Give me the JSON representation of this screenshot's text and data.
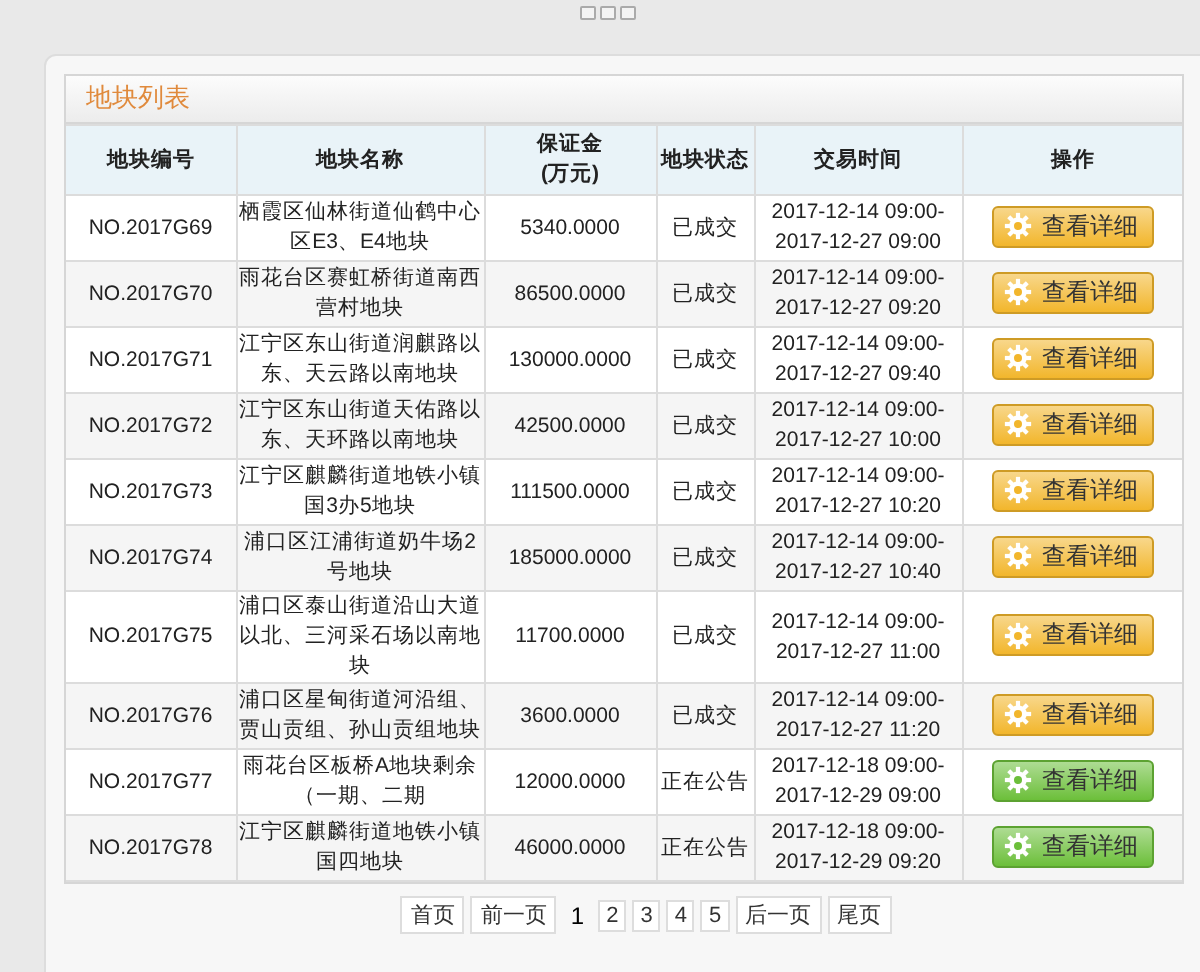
{
  "panel": {
    "title": "地块列表"
  },
  "table": {
    "columns": [
      "地块编号",
      "地块名称",
      "保证金\n(万元)",
      "地块状态",
      "交易时间",
      "操作"
    ],
    "rows": [
      {
        "code": "NO.2017G69",
        "name": "栖霞区仙林街道仙鹤中心区E3、E4地块",
        "deposit": "5340.0000",
        "status": "已成交",
        "time_start": "2017-12-14 09:00-",
        "time_end": "2017-12-27 09:00",
        "button": {
          "label": "查看详细",
          "color": "#f2b62c"
        }
      },
      {
        "code": "NO.2017G70",
        "name": "雨花台区赛虹桥街道南西营村地块",
        "deposit": "86500.0000",
        "status": "已成交",
        "time_start": "2017-12-14 09:00-",
        "time_end": "2017-12-27 09:20",
        "button": {
          "label": "查看详细",
          "color": "#f2b62c"
        }
      },
      {
        "code": "NO.2017G71",
        "name": "江宁区东山街道润麒路以东、天云路以南地块",
        "deposit": "130000.0000",
        "status": "已成交",
        "time_start": "2017-12-14 09:00-",
        "time_end": "2017-12-27 09:40",
        "button": {
          "label": "查看详细",
          "color": "#f2b62c"
        }
      },
      {
        "code": "NO.2017G72",
        "name": "江宁区东山街道天佑路以东、天环路以南地块",
        "deposit": "42500.0000",
        "status": "已成交",
        "time_start": "2017-12-14 09:00-",
        "time_end": "2017-12-27 10:00",
        "button": {
          "label": "查看详细",
          "color": "#f2b62c"
        }
      },
      {
        "code": "NO.2017G73",
        "name": "江宁区麒麟街道地铁小镇国3办5地块",
        "deposit": "111500.0000",
        "status": "已成交",
        "time_start": "2017-12-14 09:00-",
        "time_end": "2017-12-27 10:20",
        "button": {
          "label": "查看详细",
          "color": "#f2b62c"
        }
      },
      {
        "code": "NO.2017G74",
        "name": "浦口区江浦街道奶牛场2号地块",
        "deposit": "185000.0000",
        "status": "已成交",
        "time_start": "2017-12-14 09:00-",
        "time_end": "2017-12-27 10:40",
        "button": {
          "label": "查看详细",
          "color": "#f2b62c"
        }
      },
      {
        "code": "NO.2017G75",
        "name": "浦口区泰山街道沿山大道以北、三河采石场以南地块",
        "deposit": "11700.0000",
        "status": "已成交",
        "time_start": "2017-12-14 09:00-",
        "time_end": "2017-12-27 11:00",
        "button": {
          "label": "查看详细",
          "color": "#f2b62c"
        }
      },
      {
        "code": "NO.2017G76",
        "name": "浦口区星甸街道河沿组、贾山贡组、孙山贡组地块",
        "deposit": "3600.0000",
        "status": "已成交",
        "time_start": "2017-12-14 09:00-",
        "time_end": "2017-12-27 11:20",
        "button": {
          "label": "查看详细",
          "color": "#f2b62c"
        }
      },
      {
        "code": "NO.2017G77",
        "name": "雨花台区板桥A地块剩余（一期、二期",
        "deposit": "12000.0000",
        "status": "正在公告",
        "time_start": "2017-12-18 09:00-",
        "time_end": "2017-12-29 09:00",
        "button": {
          "label": "查看详细",
          "color": "#6cbf3a"
        }
      },
      {
        "code": "NO.2017G78",
        "name": "江宁区麒麟街道地铁小镇国四地块",
        "deposit": "46000.0000",
        "status": "正在公告",
        "time_start": "2017-12-18 09:00-",
        "time_end": "2017-12-29 09:20",
        "button": {
          "label": "查看详细",
          "color": "#6cbf3a"
        }
      }
    ]
  },
  "pagination": [
    {
      "label": "首页",
      "kind": "link",
      "selected": false
    },
    {
      "label": "前一页",
      "kind": "link",
      "selected": false
    },
    {
      "label": "1",
      "kind": "page",
      "selected": true
    },
    {
      "label": "2",
      "kind": "page",
      "selected": false
    },
    {
      "label": "3",
      "kind": "page",
      "selected": false
    },
    {
      "label": "4",
      "kind": "page",
      "selected": false
    },
    {
      "label": "5",
      "kind": "page",
      "selected": false
    },
    {
      "label": "后一页",
      "kind": "link",
      "selected": false
    },
    {
      "label": "尾页",
      "kind": "link",
      "selected": false
    }
  ]
}
